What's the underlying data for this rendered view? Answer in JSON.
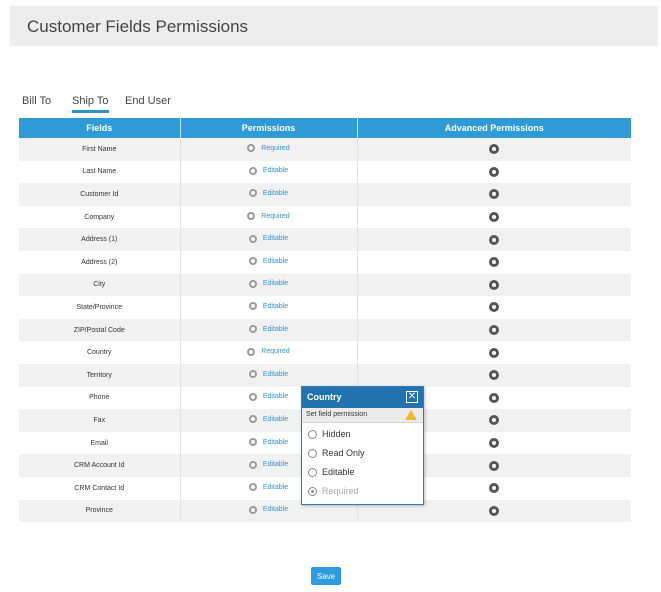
{
  "page_title": "Customer Fields Permissions",
  "tabs": [
    {
      "label": "Bill To",
      "active": false
    },
    {
      "label": "Ship To",
      "active": true
    },
    {
      "label": "End User",
      "active": false
    }
  ],
  "table": {
    "headers": [
      "Fields",
      "Permissions",
      "Advanced Permissions"
    ],
    "rows": [
      {
        "field": "First Name",
        "permission": "Required"
      },
      {
        "field": "Last Name",
        "permission": "Editable"
      },
      {
        "field": "Customer Id",
        "permission": "Editable"
      },
      {
        "field": "Company",
        "permission": "Required"
      },
      {
        "field": "Address (1)",
        "permission": "Editable"
      },
      {
        "field": "Address (2)",
        "permission": "Editable"
      },
      {
        "field": "City",
        "permission": "Editable"
      },
      {
        "field": "State/Province",
        "permission": "Editable"
      },
      {
        "field": "ZIP/Postal Code",
        "permission": "Editable"
      },
      {
        "field": "Country",
        "permission": "Required"
      },
      {
        "field": "Territory",
        "permission": "Editable"
      },
      {
        "field": "Phone",
        "permission": "Editable"
      },
      {
        "field": "Fax",
        "permission": "Editable"
      },
      {
        "field": "Email",
        "permission": "Editable"
      },
      {
        "field": "CRM Account Id",
        "permission": "Editable"
      },
      {
        "field": "CRM Contact Id",
        "permission": "Editable"
      },
      {
        "field": "Province",
        "permission": "Editable"
      }
    ]
  },
  "popup": {
    "title": "Country",
    "close": "✕",
    "subtitle": "Set field permission",
    "options": [
      {
        "label": "Hidden",
        "selected": false,
        "disabled": false
      },
      {
        "label": "Read Only",
        "selected": false,
        "disabled": false
      },
      {
        "label": "Editable",
        "selected": false,
        "disabled": false
      },
      {
        "label": "Required",
        "selected": true,
        "disabled": true
      }
    ]
  },
  "save_label": "Save",
  "colors": {
    "header_blue": "#2e9bd6",
    "link_blue": "#3a8fd0",
    "popup_blue": "#2272b0",
    "warning": "#f2b632"
  }
}
